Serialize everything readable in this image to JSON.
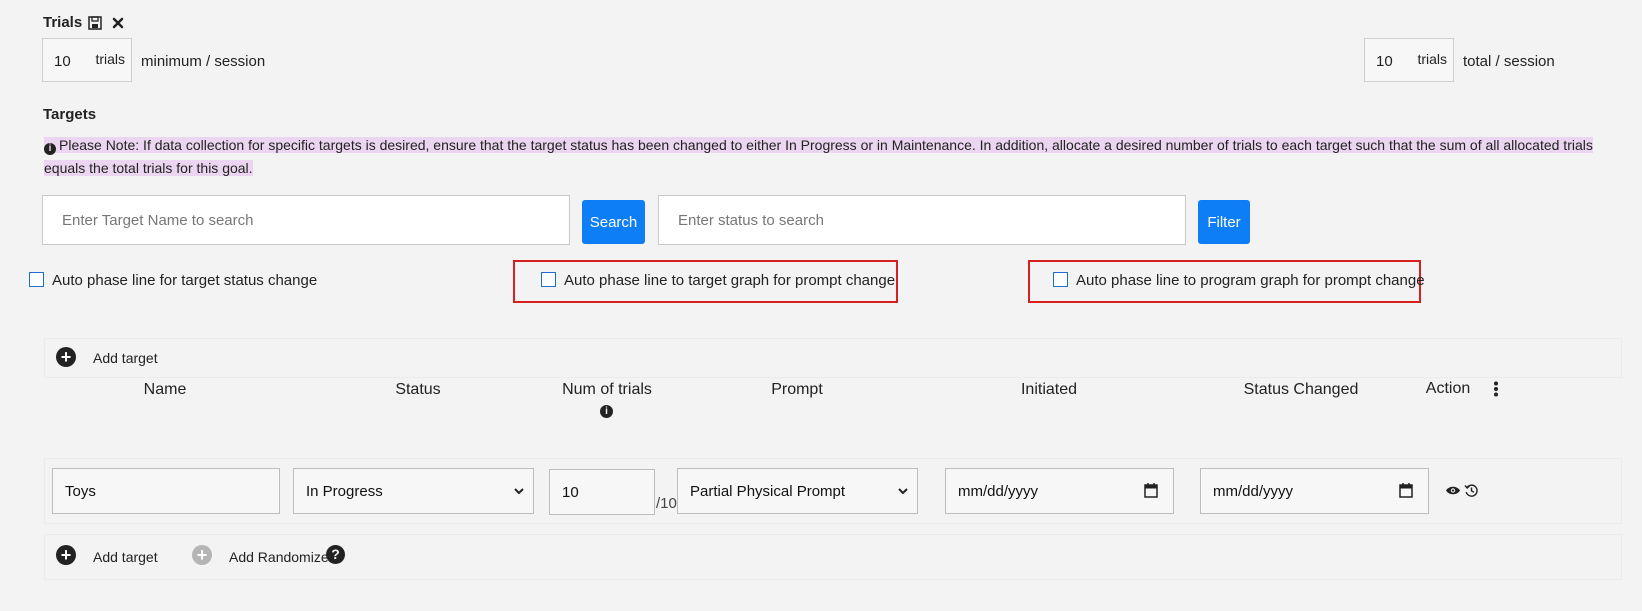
{
  "trials": {
    "heading": "Trials",
    "min_value": "10",
    "min_unit": "trials",
    "min_label": "minimum / session",
    "total_value": "10",
    "total_unit": "trials",
    "total_label": "total / session"
  },
  "targets": {
    "heading": "Targets",
    "note_line1": "Please Note: If data collection for specific targets is desired, ensure that the target status has been changed to either In Progress or in Maintenance. In addition, allocate a desired number of trials to each target such that the sum of all allocated trials",
    "note_line2": "equals the total trials for this goal."
  },
  "search": {
    "name_placeholder": "Enter Target Name to search",
    "search_label": "Search",
    "status_placeholder": "Enter status to search",
    "filter_label": "Filter"
  },
  "options": {
    "auto_status": "Auto phase line for target status change",
    "auto_target_graph": "Auto phase line to target graph for prompt change",
    "auto_program_graph": "Auto phase line to program graph for prompt change"
  },
  "table": {
    "add_target_label": "Add target",
    "columns": {
      "name": "Name",
      "status": "Status",
      "num_trials": "Num of trials",
      "prompt": "Prompt",
      "initiated": "Initiated",
      "status_changed": "Status Changed",
      "action": "Action"
    },
    "row": {
      "name": "Toys",
      "status": "In Progress",
      "num_trials": "10",
      "num_trials_suffix": "/10",
      "prompt": "Partial Physical Prompt",
      "initiated": "mm/dd/yyyy",
      "status_changed": "mm/dd/yyyy"
    },
    "footer": {
      "add_target_label": "Add target",
      "add_randomize_label": "Add Randomize"
    }
  },
  "colors": {
    "accent": "#0d7ef5",
    "highlight": "#ecd5f0",
    "red_outline": "#d62020"
  }
}
